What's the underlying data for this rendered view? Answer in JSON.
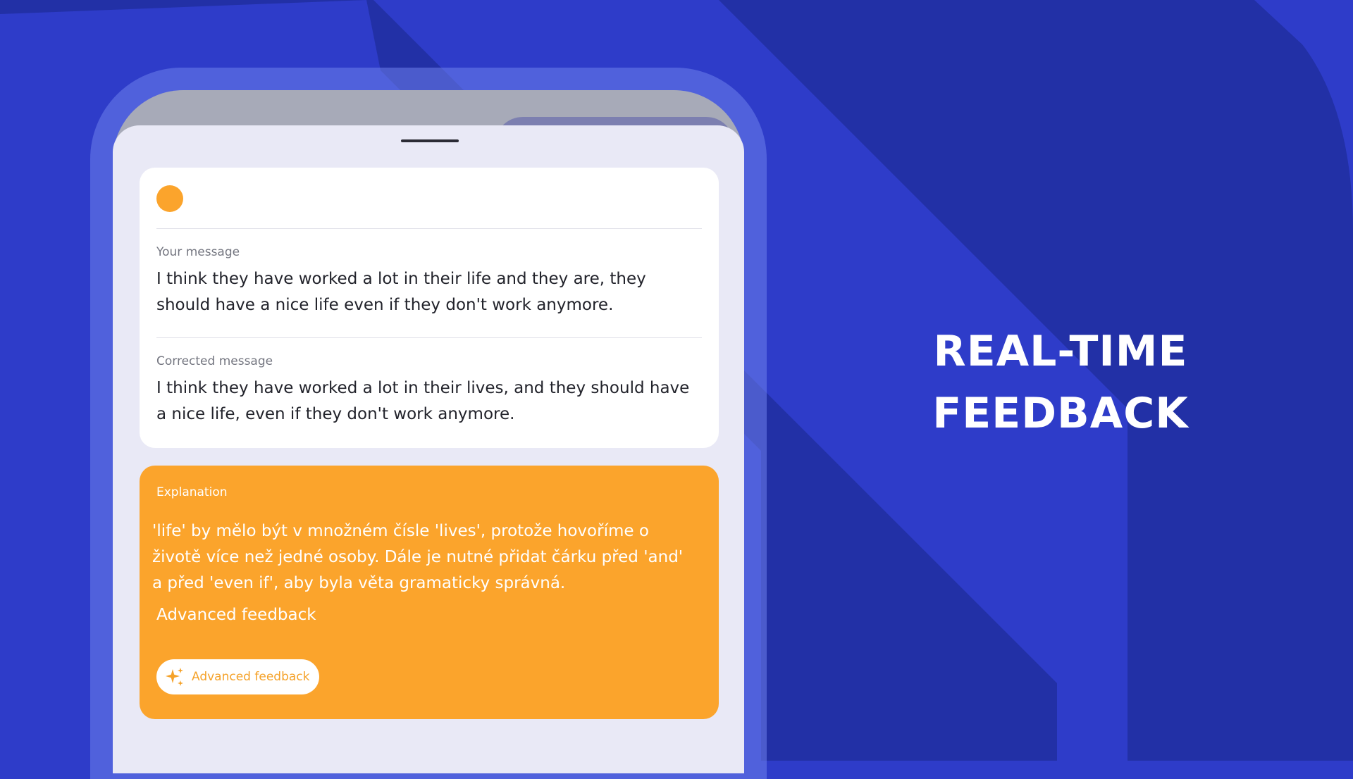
{
  "headline": {
    "line1": "REAL-TIME",
    "line2": "FEEDBACK"
  },
  "colors": {
    "background": "#2e3cc9",
    "background_dark": "#2230a6",
    "accent_orange": "#fba42c",
    "card_bg": "#ffffff",
    "sheet_bg": "#e9e9f6"
  },
  "sheet": {
    "your_message": {
      "label": "Your message",
      "text": "I think they have worked a lot in their life and they are, they should have a nice life even if they don't work anymore."
    },
    "corrected_message": {
      "label": "Corrected message",
      "text": "I think they have worked a lot in their lives, and they should have a nice life, even if they don't work anymore."
    },
    "explanation": {
      "label": "Explanation",
      "text": "'life' by mělo být v množném čísle 'lives', protože hovoříme o životě více než jedné osoby. Dále je nutné přidat čárku před 'and' a před 'even if', aby byla věta gramaticky správná.",
      "extra": "Advanced feedback"
    },
    "advanced_button": {
      "label": "Advanced feedback",
      "icon": "sparkle-icon"
    }
  }
}
